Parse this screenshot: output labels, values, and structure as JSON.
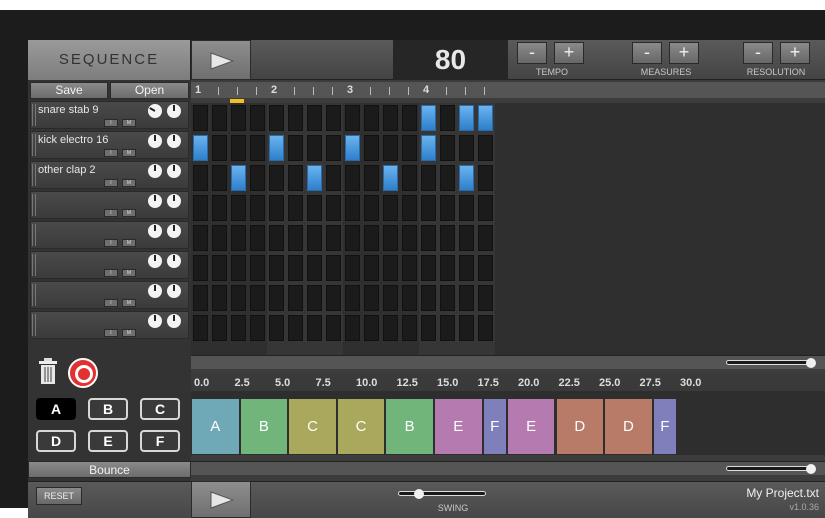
{
  "header": {
    "title": "SEQUENCE",
    "tempo_value": "80",
    "tempo_label": "TEMPO",
    "measures_label": "MEASURES",
    "resolution_label": "RESOLUTION",
    "minus": "-",
    "plus": "+"
  },
  "left_panel": {
    "save_label": "Save",
    "open_label": "Open",
    "tracks": [
      {
        "name": "snare stab 9"
      },
      {
        "name": "kick electro 16"
      },
      {
        "name": "other clap 2"
      },
      {
        "name": ""
      },
      {
        "name": ""
      },
      {
        "name": ""
      },
      {
        "name": ""
      },
      {
        "name": ""
      }
    ],
    "track_button_i": "I",
    "track_button_m": "M",
    "patterns": [
      "A",
      "B",
      "C",
      "D",
      "E",
      "F"
    ],
    "selected_pattern": "A",
    "bounce_label": "Bounce"
  },
  "grid": {
    "ruler_beats": [
      "1",
      "2",
      "3",
      "4"
    ],
    "steps": 16,
    "rows": [
      [
        0,
        0,
        0,
        0,
        0,
        0,
        0,
        0,
        0,
        0,
        0,
        0,
        1,
        0,
        1,
        1
      ],
      [
        1,
        0,
        0,
        0,
        1,
        0,
        0,
        0,
        1,
        0,
        0,
        0,
        1,
        0,
        0,
        0
      ],
      [
        0,
        0,
        1,
        0,
        0,
        0,
        1,
        0,
        0,
        0,
        1,
        0,
        0,
        0,
        1,
        0
      ],
      [
        0,
        0,
        0,
        0,
        0,
        0,
        0,
        0,
        0,
        0,
        0,
        0,
        0,
        0,
        0,
        0
      ],
      [
        0,
        0,
        0,
        0,
        0,
        0,
        0,
        0,
        0,
        0,
        0,
        0,
        0,
        0,
        0,
        0
      ],
      [
        0,
        0,
        0,
        0,
        0,
        0,
        0,
        0,
        0,
        0,
        0,
        0,
        0,
        0,
        0,
        0
      ],
      [
        0,
        0,
        0,
        0,
        0,
        0,
        0,
        0,
        0,
        0,
        0,
        0,
        0,
        0,
        0,
        0
      ],
      [
        0,
        0,
        0,
        0,
        0,
        0,
        0,
        0,
        0,
        0,
        0,
        0,
        0,
        0,
        0,
        0
      ]
    ]
  },
  "song": {
    "ruler_labels": [
      "0.0",
      "2.5",
      "5.0",
      "7.5",
      "10.0",
      "12.5",
      "15.0",
      "17.5",
      "20.0",
      "22.5",
      "25.0",
      "27.5",
      "30.0"
    ],
    "blocks": [
      {
        "label": "A",
        "color": "#6fa9b8",
        "length": 3
      },
      {
        "label": "B",
        "color": "#72b57b",
        "length": 3
      },
      {
        "label": "C",
        "color": "#a9a85c",
        "length": 3
      },
      {
        "label": "C",
        "color": "#a9a85c",
        "length": 3
      },
      {
        "label": "B",
        "color": "#72b57b",
        "length": 3
      },
      {
        "label": "E",
        "color": "#b57bb1",
        "length": 3
      },
      {
        "label": "F",
        "color": "#7f7fbc",
        "length": 1.5
      },
      {
        "label": "E",
        "color": "#b57bb1",
        "length": 3
      },
      {
        "label": "D",
        "color": "#b77b68",
        "length": 3
      },
      {
        "label": "D",
        "color": "#b77b68",
        "length": 3
      },
      {
        "label": "F",
        "color": "#7f7fbc",
        "length": 1.5
      }
    ]
  },
  "footer": {
    "reset_label": "RESET",
    "swing_label": "SWING",
    "project_name": "My Project.txt",
    "version": "v1.0.36"
  }
}
